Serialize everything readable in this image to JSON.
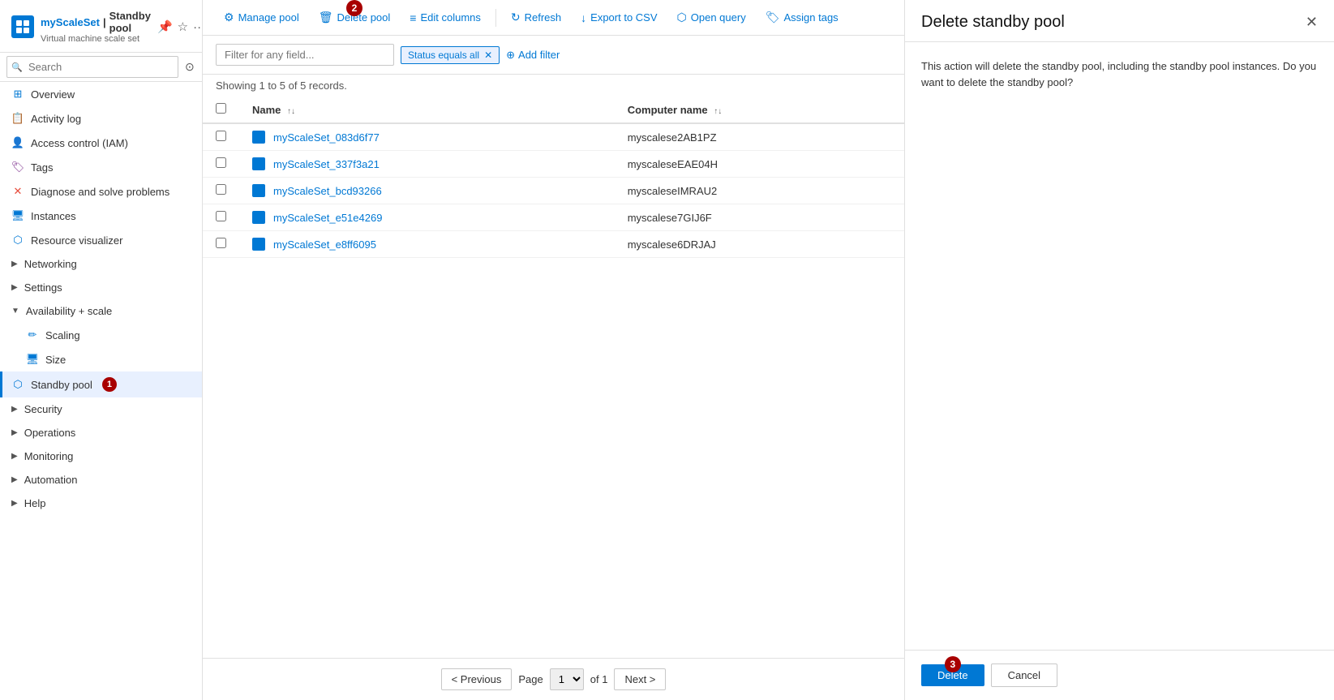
{
  "brand": {
    "title": "myScaleSet",
    "subtitle": "Virtual machine scale set",
    "separator": "|",
    "page_title": "Standby pool"
  },
  "search": {
    "placeholder": "Search",
    "value": ""
  },
  "sidebar": {
    "nav_items": [
      {
        "id": "overview",
        "label": "Overview",
        "icon": "grid",
        "type": "item"
      },
      {
        "id": "activity-log",
        "label": "Activity log",
        "icon": "log",
        "type": "item"
      },
      {
        "id": "access-control",
        "label": "Access control (IAM)",
        "icon": "user-shield",
        "type": "item"
      },
      {
        "id": "tags",
        "label": "Tags",
        "icon": "tag",
        "type": "item"
      },
      {
        "id": "diagnose",
        "label": "Diagnose and solve problems",
        "icon": "wrench",
        "type": "item"
      },
      {
        "id": "instances",
        "label": "Instances",
        "icon": "server",
        "type": "item"
      },
      {
        "id": "resource-visualizer",
        "label": "Resource visualizer",
        "icon": "visualizer",
        "type": "item"
      },
      {
        "id": "networking",
        "label": "Networking",
        "icon": "network",
        "type": "group",
        "expanded": false
      },
      {
        "id": "settings",
        "label": "Settings",
        "icon": "settings",
        "type": "group",
        "expanded": false
      },
      {
        "id": "availability-scale",
        "label": "Availability + scale",
        "icon": "scale",
        "type": "group",
        "expanded": true
      },
      {
        "id": "scaling",
        "label": "Scaling",
        "icon": "scaling",
        "type": "sub-item"
      },
      {
        "id": "size",
        "label": "Size",
        "icon": "size",
        "type": "sub-item"
      },
      {
        "id": "standby-pool",
        "label": "Standby pool",
        "icon": "pool",
        "type": "sub-item",
        "active": true,
        "badge": 1
      },
      {
        "id": "security",
        "label": "Security",
        "icon": "security",
        "type": "group",
        "expanded": false
      },
      {
        "id": "operations",
        "label": "Operations",
        "icon": "ops",
        "type": "group",
        "expanded": false
      },
      {
        "id": "monitoring",
        "label": "Monitoring",
        "icon": "monitor",
        "type": "group",
        "expanded": false
      },
      {
        "id": "automation",
        "label": "Automation",
        "icon": "automation",
        "type": "group",
        "expanded": false
      },
      {
        "id": "help",
        "label": "Help",
        "icon": "help",
        "type": "group",
        "expanded": false
      }
    ]
  },
  "toolbar": {
    "buttons": [
      {
        "id": "manage-pool",
        "label": "Manage pool",
        "icon": "⚙"
      },
      {
        "id": "delete-pool",
        "label": "Delete pool",
        "icon": "🗑",
        "badge": 2
      },
      {
        "id": "edit-columns",
        "label": "Edit columns",
        "icon": "≡"
      },
      {
        "id": "refresh",
        "label": "Refresh",
        "icon": "↻"
      },
      {
        "id": "export-csv",
        "label": "Export to CSV",
        "icon": "↓"
      },
      {
        "id": "open-query",
        "label": "Open query",
        "icon": "⬡"
      },
      {
        "id": "assign-tags",
        "label": "Assign tags",
        "icon": "🏷"
      }
    ]
  },
  "filter": {
    "placeholder": "Filter for any field...",
    "active_filter": "Status equals all",
    "add_filter_label": "+ Add filter"
  },
  "records": {
    "info": "Showing 1 to 5 of 5 records."
  },
  "table": {
    "columns": [
      {
        "id": "name",
        "label": "Name",
        "sortable": true
      },
      {
        "id": "computer-name",
        "label": "Computer name",
        "sortable": true
      }
    ],
    "rows": [
      {
        "id": "row1",
        "name": "myScaleSet_083d6f77",
        "computer_name": "myscalese2AB1PZ"
      },
      {
        "id": "row2",
        "name": "myScaleSet_337f3a21",
        "computer_name": "myscaleseEAE04H"
      },
      {
        "id": "row3",
        "name": "myScaleSet_bcd93266",
        "computer_name": "myscaleseIMRAU2"
      },
      {
        "id": "row4",
        "name": "myScaleSet_e51e4269",
        "computer_name": "myscalese7GIJ6F"
      },
      {
        "id": "row5",
        "name": "myScaleSet_e8ff6095",
        "computer_name": "myscalese6DRJAJ"
      }
    ]
  },
  "pagination": {
    "previous_label": "< Previous",
    "next_label": "Next >",
    "page_label": "Page",
    "of_label": "of 1",
    "current_page": "1"
  },
  "panel": {
    "title": "Delete standby pool",
    "description": "This action will delete the standby pool, including the standby pool instances. Do you want to delete the standby pool?",
    "delete_label": "Delete",
    "cancel_label": "Cancel",
    "badge": 3,
    "close_icon": "✕"
  }
}
